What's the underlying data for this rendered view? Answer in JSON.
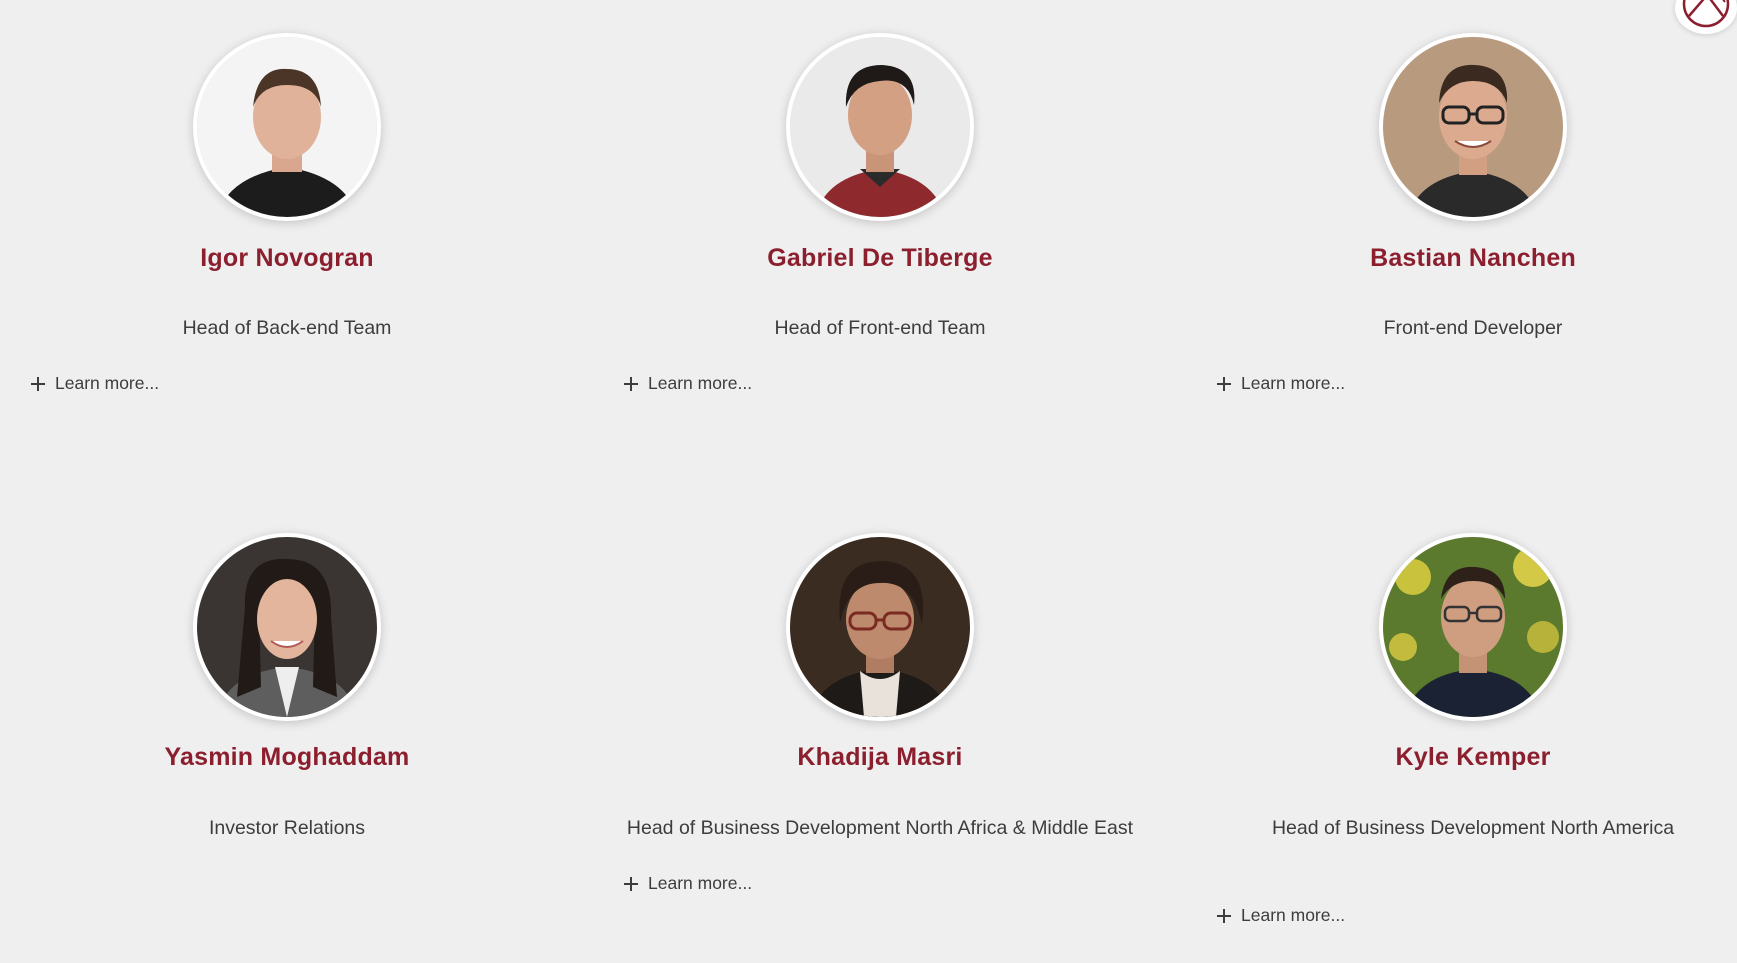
{
  "team": {
    "members": [
      {
        "name": "Igor Novogran",
        "role": "Head of Back-end Team",
        "learn_more": "Learn more..."
      },
      {
        "name": "Gabriel De Tiberge",
        "role": "Head of Front-end Team",
        "learn_more": "Learn more..."
      },
      {
        "name": "Bastian Nanchen",
        "role": "Front-end Developer",
        "learn_more": "Learn more..."
      },
      {
        "name": "Yasmin Moghaddam",
        "role": "Investor Relations",
        "learn_more": ""
      },
      {
        "name": "Khadija Masri",
        "role": "Head of Business Development North Africa & Middle East",
        "learn_more": "Learn more..."
      },
      {
        "name": "Kyle Kemper",
        "role": "Head of Business Development North America",
        "learn_more": "Learn more..."
      }
    ]
  },
  "colors": {
    "background": "#efeff0",
    "name_accent": "#8c1f2e",
    "body_text": "#3d3d3d"
  },
  "icons": {
    "expand": "plus-icon",
    "logo": "brand-logo-icon"
  }
}
